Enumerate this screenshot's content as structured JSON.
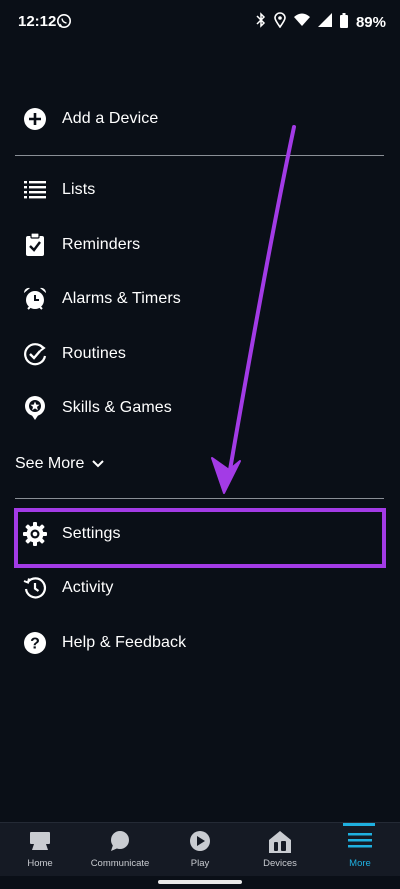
{
  "status_bar": {
    "time": "12:12",
    "battery": "89%",
    "icons": [
      "whatsapp-icon",
      "bluetooth-icon",
      "location-icon",
      "wifi-icon",
      "signal-icon",
      "battery-icon"
    ]
  },
  "menu": {
    "add_device": "Add a Device",
    "items": [
      {
        "label": "Lists",
        "icon": "list-icon"
      },
      {
        "label": "Reminders",
        "icon": "clipboard-check-icon"
      },
      {
        "label": "Alarms & Timers",
        "icon": "alarm-icon"
      },
      {
        "label": "Routines",
        "icon": "routines-icon"
      },
      {
        "label": "Skills & Games",
        "icon": "skills-icon"
      }
    ],
    "see_more": "See More",
    "settings": "Settings",
    "activity": "Activity",
    "help": "Help & Feedback"
  },
  "bottom_nav": {
    "items": [
      {
        "label": "Home",
        "icon": "home-icon"
      },
      {
        "label": "Communicate",
        "icon": "chat-icon"
      },
      {
        "label": "Play",
        "icon": "play-icon"
      },
      {
        "label": "Devices",
        "icon": "devices-icon"
      },
      {
        "label": "More",
        "icon": "menu-icon"
      }
    ],
    "active": "More"
  },
  "colors": {
    "background": "#0a0f17",
    "highlight": "#a33be6",
    "accent": "#1fb0e0"
  }
}
